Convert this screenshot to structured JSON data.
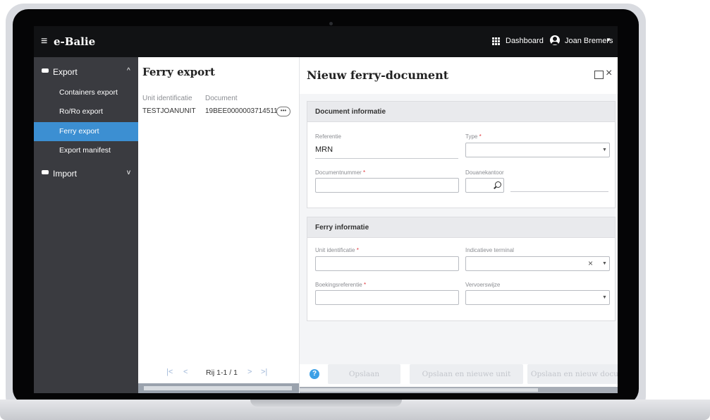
{
  "app": {
    "menu_icon": "hamburger-icon",
    "title": "e-Balie"
  },
  "topbar": {
    "dashboard_label": "Dashboard",
    "user_name": "Joan Bremers"
  },
  "sidebar": {
    "export_label": "Export",
    "import_label": "Import",
    "export_items": [
      {
        "label": "Containers export",
        "active": false
      },
      {
        "label": "Ro/Ro export",
        "active": false
      },
      {
        "label": "Ferry export",
        "active": true
      },
      {
        "label": "Export manifest",
        "active": false
      }
    ]
  },
  "list": {
    "title": "Ferry export",
    "columns": [
      "Unit identificatie",
      "Document"
    ],
    "rows": [
      {
        "unit": "TESTJOANUNIT",
        "document": "19BEE0000003714511"
      }
    ],
    "pager_info": "Rij 1-1 / 1"
  },
  "form": {
    "title": "Nieuw ferry-document",
    "document_section": {
      "title": "Document informatie",
      "referentie_label": "Referentie",
      "referentie_value": "MRN",
      "type_label": "Type",
      "documentnummer_label": "Documentnummer",
      "douanekantoor_label": "Douanekantoor"
    },
    "ferry_section": {
      "title": "Ferry informatie",
      "unit_label": "Unit identificatie",
      "terminal_label": "Indicatieve terminal",
      "boeking_label": "Boekingsreferentie",
      "vervoer_label": "Vervoerswijze"
    },
    "required_mark": "*",
    "buttons": {
      "help": "?",
      "save": "Opslaan",
      "save_new_unit": "Opslaan en nieuwe unit",
      "save_new_doc": "Opslaan en nieuw docume"
    }
  },
  "colors": {
    "accent": "#3c8fd2",
    "sidebar": "#3a3b40",
    "topbar": "#111214",
    "required": "#e0363c"
  }
}
